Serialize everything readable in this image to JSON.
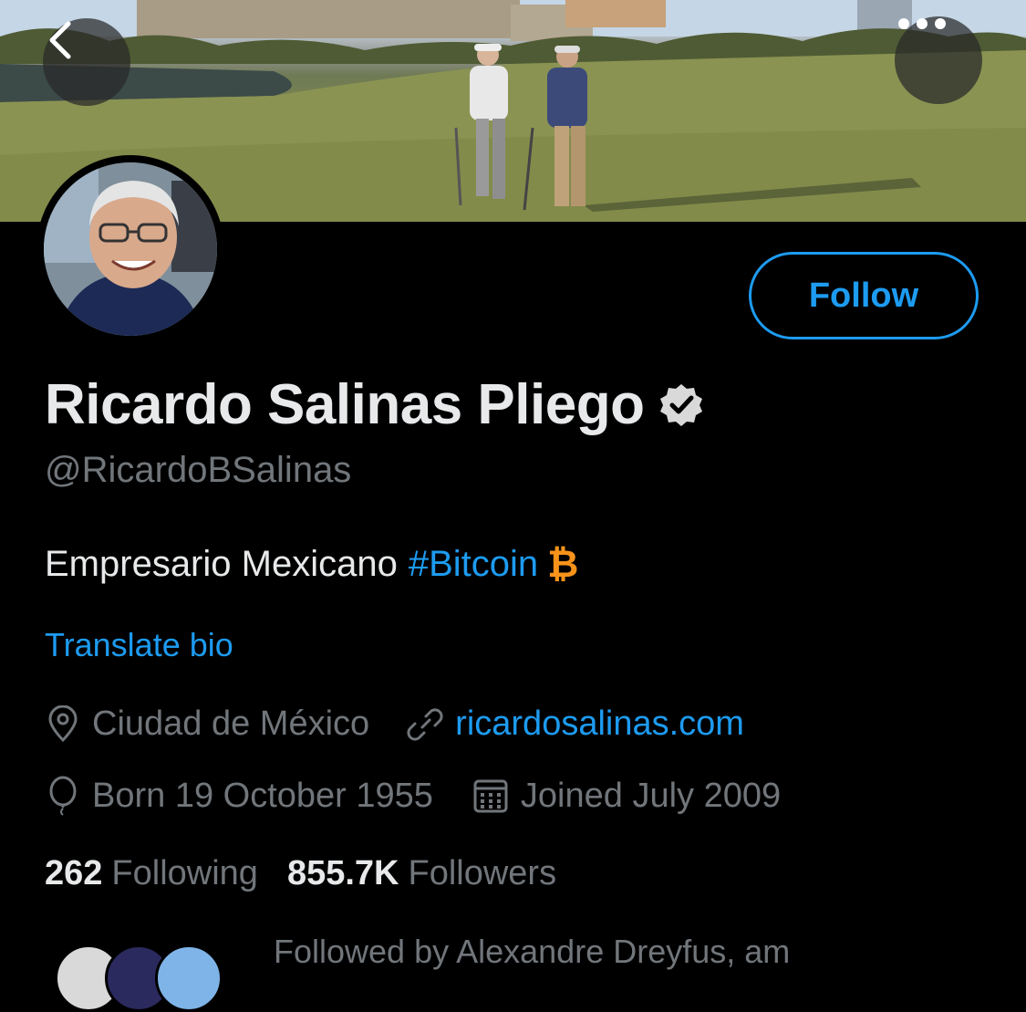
{
  "header": {
    "back_icon": "chevron-left-icon",
    "more_icon": "ellipsis-icon"
  },
  "profile": {
    "display_name": "Ricardo Salinas Pliego",
    "verified": true,
    "handle": "@RicardoBSalinas",
    "follow_label": "Follow",
    "bio_text": "Empresario Mexicano",
    "bio_hashtag": "#Bitcoin",
    "bio_emoji": "₿",
    "translate_label": "Translate bio",
    "location": "Ciudad de México",
    "website": "ricardosalinas.com",
    "birthday": "Born 19 October 1955",
    "joined": "Joined July 2009",
    "following_count": "262",
    "following_label": "Following",
    "followers_count": "855.7K",
    "followers_label": "Followers",
    "followed_by": "Followed by Alexandre Dreyfus, am"
  },
  "colors": {
    "background": "#000000",
    "accent": "#1d9bf0",
    "secondary_text": "#71767b",
    "primary_text": "#e7e9ea",
    "bitcoin": "#f7931a"
  }
}
